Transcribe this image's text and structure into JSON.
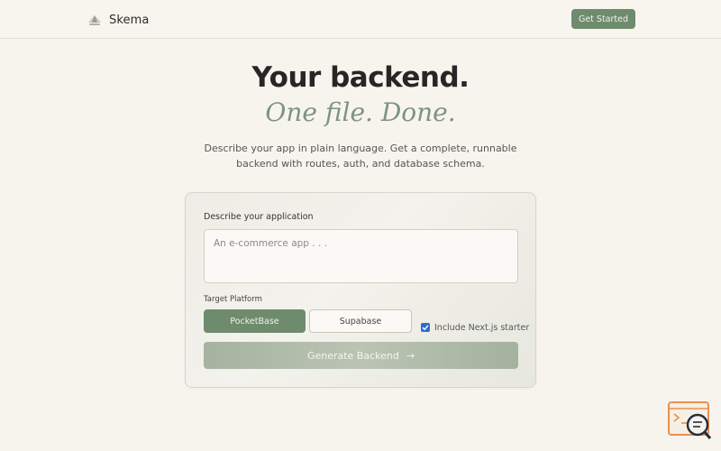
{
  "nav": {
    "brand": "Skema",
    "cta_label": "Get Started"
  },
  "hero": {
    "title": "Your backend.",
    "subtitle": "One file. Done.",
    "description": "Describe your app in plain language. Get a complete, runnable backend with routes, auth, and database schema."
  },
  "form": {
    "app_label": "Describe your application",
    "app_placeholder": "An e-commerce app . . .",
    "platform_label": "Target Platform",
    "platforms": [
      {
        "label": "PocketBase",
        "selected": true
      },
      {
        "label": "Supabase",
        "selected": false
      }
    ],
    "nextjs_label": "Include Next.js starter",
    "nextjs_checked": true,
    "generate_label": "Generate Backend",
    "generate_icon": "arrow-right-icon"
  },
  "colors": {
    "accent": "#6f8b6d",
    "subtitle": "#7d957b",
    "background": "#f7f4ee",
    "checkbox": "#2f6bd1"
  }
}
